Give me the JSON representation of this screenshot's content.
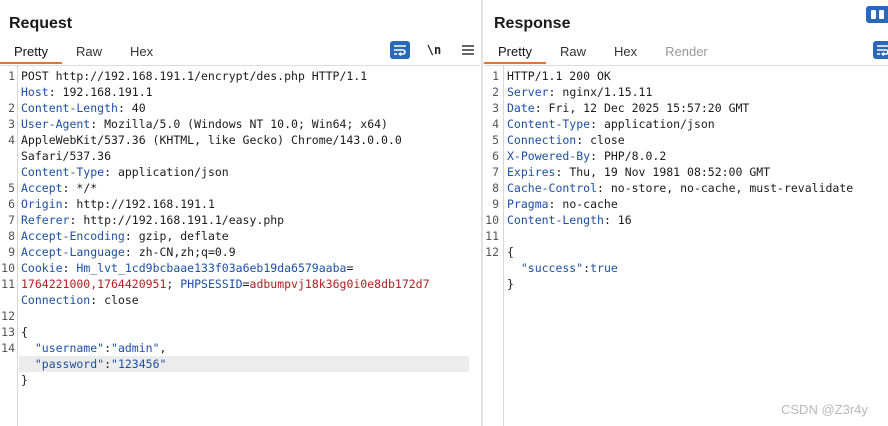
{
  "request": {
    "title": "Request",
    "tabs": [
      "Pretty",
      "Raw",
      "Hex"
    ],
    "tools": {
      "wrap_icon": "wrap-lines-icon",
      "newline_toggle": "\\n",
      "menu_icon": "menu-icon"
    },
    "line_numbers": [
      "1",
      "",
      "2",
      "3",
      "4",
      "",
      "",
      "5",
      "6",
      "7",
      "8",
      "9",
      "10",
      "11",
      "",
      "12",
      "13",
      "14",
      "",
      ""
    ],
    "lines": [
      {
        "parts": [
          {
            "t": "POST http://192.168.191.1/encrypt/des.php HTTP/1.1",
            "c": "v"
          }
        ]
      },
      {
        "parts": [
          {
            "t": "Host",
            "c": "k"
          },
          {
            "t": ": 192.168.191.1",
            "c": "v"
          }
        ]
      },
      {
        "parts": [
          {
            "t": "Content-Length",
            "c": "k"
          },
          {
            "t": ": 40",
            "c": "v"
          }
        ]
      },
      {
        "parts": [
          {
            "t": "User-Agent",
            "c": "k"
          },
          {
            "t": ": Mozilla/5.0 (Windows NT 10.0; Win64; x64)",
            "c": "v"
          }
        ]
      },
      {
        "parts": [
          {
            "t": "AppleWebKit/537.36 (KHTML, like Gecko) Chrome/143.0.0.0",
            "c": "v"
          }
        ]
      },
      {
        "parts": [
          {
            "t": "Safari/537.36",
            "c": "v"
          }
        ]
      },
      {
        "parts": [
          {
            "t": "Content-Type",
            "c": "k"
          },
          {
            "t": ": application/json",
            "c": "v"
          }
        ]
      },
      {
        "parts": [
          {
            "t": "Accept",
            "c": "k"
          },
          {
            "t": ": */*",
            "c": "v"
          }
        ]
      },
      {
        "parts": [
          {
            "t": "Origin",
            "c": "k"
          },
          {
            "t": ": http://192.168.191.1",
            "c": "v"
          }
        ]
      },
      {
        "parts": [
          {
            "t": "Referer",
            "c": "k"
          },
          {
            "t": ": http://192.168.191.1/easy.php",
            "c": "v"
          }
        ]
      },
      {
        "parts": [
          {
            "t": "Accept-Encoding",
            "c": "k"
          },
          {
            "t": ": gzip, deflate",
            "c": "v"
          }
        ]
      },
      {
        "parts": [
          {
            "t": "Accept-Language",
            "c": "k"
          },
          {
            "t": ": zh-CN,zh;q=0.9",
            "c": "v"
          }
        ]
      },
      {
        "parts": [
          {
            "t": "Cookie",
            "c": "k"
          },
          {
            "t": ": ",
            "c": "v"
          },
          {
            "t": "Hm_lvt_1cd9bcbaae133f03a6eb19da6579aaba",
            "c": "ck"
          },
          {
            "t": "=",
            "c": "v"
          }
        ]
      },
      {
        "parts": [
          {
            "t": "1764221000,1764420951",
            "c": "cv"
          },
          {
            "t": "; ",
            "c": "v"
          },
          {
            "t": "PHPSESSID",
            "c": "ck"
          },
          {
            "t": "=",
            "c": "v"
          },
          {
            "t": "adbumpvj18k36g0i0e8db172d7",
            "c": "cv"
          }
        ]
      },
      {
        "parts": [
          {
            "t": "Connection",
            "c": "k"
          },
          {
            "t": ": close",
            "c": "v"
          }
        ]
      },
      {
        "parts": []
      },
      {
        "parts": [
          {
            "t": "{",
            "c": "v"
          }
        ]
      },
      {
        "parts": [
          {
            "t": "  \"username\"",
            "c": "js"
          },
          {
            "t": ":",
            "c": "v"
          },
          {
            "t": "\"admin\"",
            "c": "js"
          },
          {
            "t": ",",
            "c": "v"
          }
        ]
      },
      {
        "parts": [
          {
            "t": "  \"password\"",
            "c": "js"
          },
          {
            "t": ":",
            "c": "v"
          },
          {
            "t": "\"123456\"",
            "c": "js"
          }
        ]
      },
      {
        "parts": [
          {
            "t": "}",
            "c": "v"
          }
        ]
      }
    ]
  },
  "response": {
    "title": "Response",
    "tabs": [
      "Pretty",
      "Raw",
      "Hex",
      "Render"
    ],
    "tools": {
      "wrap_icon": "wrap-lines-icon"
    },
    "line_numbers": [
      "1",
      "2",
      "3",
      "4",
      "5",
      "6",
      "7",
      "8",
      "9",
      "10",
      "11",
      "12",
      "",
      ""
    ],
    "lines": [
      {
        "parts": [
          {
            "t": "HTTP/1.1 200 OK",
            "c": "v"
          }
        ]
      },
      {
        "parts": [
          {
            "t": "Server",
            "c": "k"
          },
          {
            "t": ": nginx/1.15.11",
            "c": "v"
          }
        ]
      },
      {
        "parts": [
          {
            "t": "Date",
            "c": "k"
          },
          {
            "t": ": Fri, 12 Dec 2025 15:57:20 GMT",
            "c": "v"
          }
        ]
      },
      {
        "parts": [
          {
            "t": "Content-Type",
            "c": "k"
          },
          {
            "t": ": application/json",
            "c": "v"
          }
        ]
      },
      {
        "parts": [
          {
            "t": "Connection",
            "c": "k"
          },
          {
            "t": ": close",
            "c": "v"
          }
        ]
      },
      {
        "parts": [
          {
            "t": "X-Powered-By",
            "c": "k"
          },
          {
            "t": ": PHP/8.0.2",
            "c": "v"
          }
        ]
      },
      {
        "parts": [
          {
            "t": "Expires",
            "c": "k"
          },
          {
            "t": ": Thu, 19 Nov 1981 08:52:00 GMT",
            "c": "v"
          }
        ]
      },
      {
        "parts": [
          {
            "t": "Cache-Control",
            "c": "k"
          },
          {
            "t": ": no-store, no-cache, must-revalidate",
            "c": "v"
          }
        ]
      },
      {
        "parts": [
          {
            "t": "Pragma",
            "c": "k"
          },
          {
            "t": ": no-cache",
            "c": "v"
          }
        ]
      },
      {
        "parts": [
          {
            "t": "Content-Length",
            "c": "k"
          },
          {
            "t": ": 16",
            "c": "v"
          }
        ]
      },
      {
        "parts": []
      },
      {
        "parts": [
          {
            "t": "{",
            "c": "v"
          }
        ]
      },
      {
        "parts": [
          {
            "t": "  \"success\"",
            "c": "js"
          },
          {
            "t": ":",
            "c": "v"
          },
          {
            "t": "true",
            "c": "js"
          }
        ]
      },
      {
        "parts": [
          {
            "t": "}",
            "c": "v"
          }
        ]
      }
    ]
  },
  "colors": {
    "accent_tab": "#e8722a",
    "header_key": "#1d4fa3",
    "cookie_value": "#b02020",
    "button_blue": "#2a69b8"
  },
  "watermark": "CSDN @Z3r4y"
}
